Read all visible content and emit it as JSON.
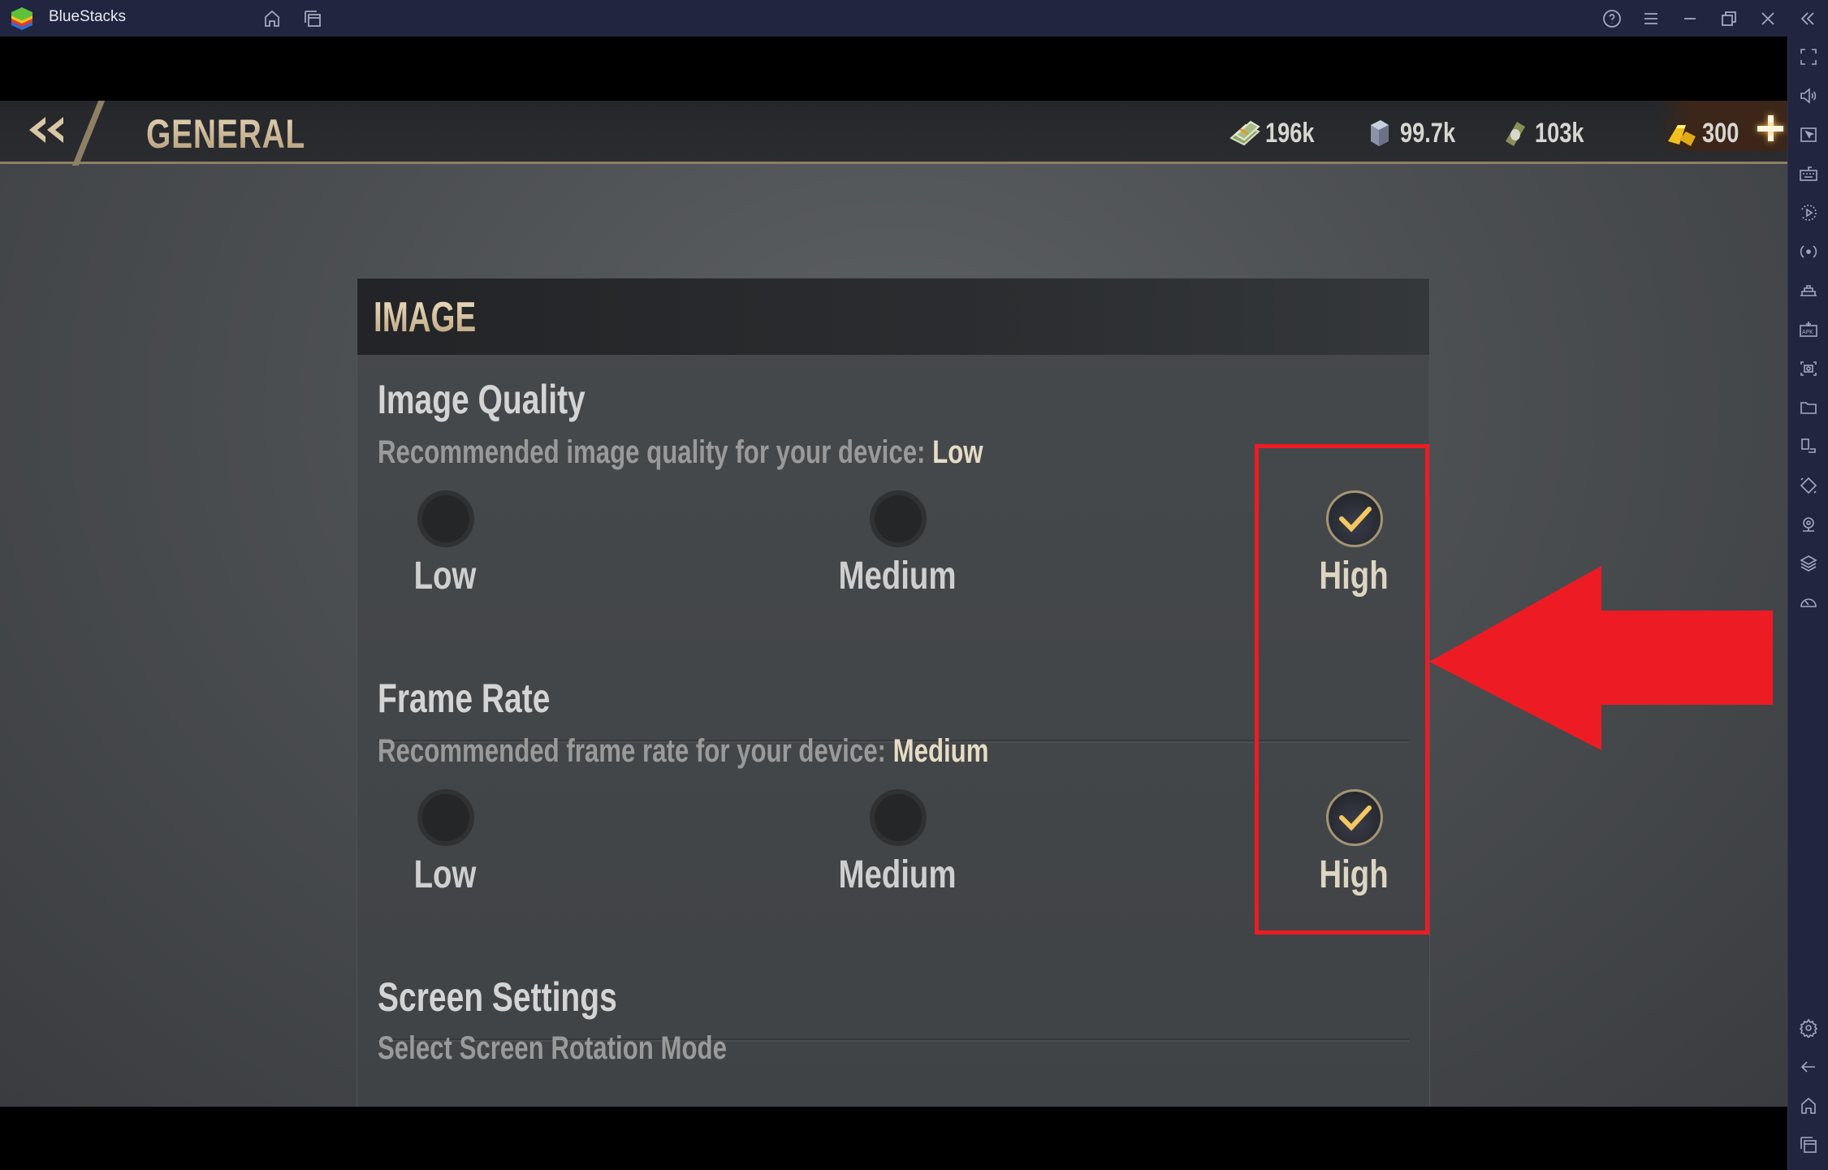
{
  "window": {
    "app_name": "BlueStacks",
    "titlebar_icons": [
      "home-icon",
      "multi-instance-icon"
    ],
    "controls": [
      "help-icon",
      "menu-icon",
      "minimize-icon",
      "restore-icon",
      "close-icon",
      "collapse-sidebar-icon"
    ]
  },
  "sidebar": {
    "top_tools": [
      "fullscreen",
      "volume",
      "pointer-mode",
      "keyboard-controls",
      "macro-recorder",
      "rotate",
      "game-controls",
      "install-apk",
      "screenshot",
      "media-folder",
      "multi-instance",
      "shake",
      "location",
      "layers",
      "performance"
    ],
    "bottom_tools": [
      "settings",
      "back",
      "home",
      "recent-apps"
    ]
  },
  "game": {
    "header": {
      "title": "GENERAL",
      "resources": [
        {
          "name": "cash",
          "value": "196k"
        },
        {
          "name": "steel",
          "value": "99.7k"
        },
        {
          "name": "fuel",
          "value": "103k"
        },
        {
          "name": "gold",
          "value": "300"
        }
      ]
    },
    "panel": {
      "title": "IMAGE",
      "sections": [
        {
          "title": "Image Quality",
          "desc_prefix": "Recommended image quality for your device: ",
          "desc_value": "Low",
          "options": [
            "Low",
            "Medium",
            "High"
          ],
          "selected": "High"
        },
        {
          "title": "Frame Rate",
          "desc_prefix": "Recommended frame rate for your device: ",
          "desc_value": "Medium",
          "options": [
            "Low",
            "Medium",
            "High"
          ],
          "selected": "High"
        },
        {
          "title": "Screen Settings",
          "desc_prefix": "Select Screen Rotation Mode"
        }
      ]
    }
  },
  "annotation": {
    "highlight_color": "#ed1c24",
    "highlight_target": "High options column",
    "arrow_direction": "left"
  }
}
